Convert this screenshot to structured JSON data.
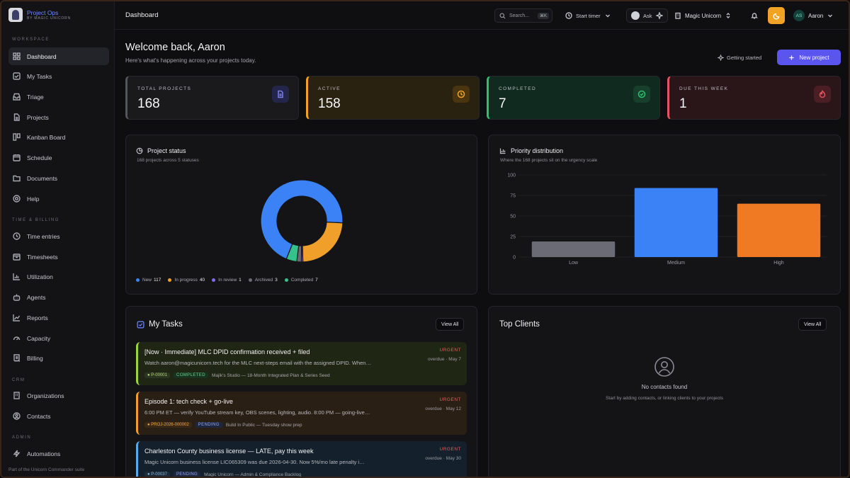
{
  "brand": {
    "title": "Project Ops",
    "subtitle": "BY MAGIC UNICORN"
  },
  "sidebar": {
    "sections": [
      {
        "label": "WORKSPACE"
      },
      {
        "label": "TIME & BILLING"
      },
      {
        "label": "CRM"
      },
      {
        "label": "ADMIN"
      }
    ],
    "items": [
      {
        "label": "Dashboard",
        "icon": "grid-icon",
        "active": true
      },
      {
        "label": "My Tasks",
        "icon": "checkbox-icon"
      },
      {
        "label": "Triage",
        "icon": "inbox-icon"
      },
      {
        "label": "Projects",
        "icon": "file-icon"
      },
      {
        "label": "Kanban Board",
        "icon": "kanban-icon"
      },
      {
        "label": "Schedule",
        "icon": "calendar-icon"
      },
      {
        "label": "Documents",
        "icon": "folder-icon"
      },
      {
        "label": "Help",
        "icon": "help-icon"
      },
      {
        "label": "Time entries",
        "icon": "clock-icon"
      },
      {
        "label": "Timesheets",
        "icon": "timesheet-icon"
      },
      {
        "label": "Utilization",
        "icon": "bar-chart-icon"
      },
      {
        "label": "Agents",
        "icon": "bot-icon"
      },
      {
        "label": "Reports",
        "icon": "line-chart-icon"
      },
      {
        "label": "Capacity",
        "icon": "gauge-icon"
      },
      {
        "label": "Billing",
        "icon": "receipt-icon"
      },
      {
        "label": "Organizations",
        "icon": "building-icon"
      },
      {
        "label": "Contacts",
        "icon": "contact-icon"
      },
      {
        "label": "Automations",
        "icon": "bolt-icon"
      }
    ],
    "footer": "Part of the Unicorn Commander suite"
  },
  "topbar": {
    "breadcrumb": "Dashboard",
    "search_label": "Search...",
    "search_shortcut": "⌘K",
    "timer_label": "Start timer",
    "ask_label": "Ask",
    "workspace_label": "Magic Unicorn",
    "user_initials": "AS",
    "user_name": "Aaron"
  },
  "header": {
    "title": "Welcome back, Aaron",
    "subtitle": "Here's what's happening across your projects today.",
    "getting_started": "Getting started",
    "new_project": "New project"
  },
  "stats": [
    {
      "label": "TOTAL PROJECTS",
      "value": "168",
      "color": "#7b7fe6"
    },
    {
      "label": "ACTIVE",
      "value": "158",
      "color": "#f1a326"
    },
    {
      "label": "COMPLETED",
      "value": "7",
      "color": "#2fbf71"
    },
    {
      "label": "DUE THIS WEEK",
      "value": "1",
      "color": "#e2555f"
    }
  ],
  "project_status": {
    "title": "Project status",
    "subtitle": "168 projects across 5 statuses",
    "legend": [
      {
        "label": "New",
        "value": "117",
        "color": "#3b82f6"
      },
      {
        "label": "In progress",
        "value": "40",
        "color": "#f0a02a"
      },
      {
        "label": "In review",
        "value": "1",
        "color": "#7c6cf0"
      },
      {
        "label": "Archived",
        "value": "3",
        "color": "#6b6b74"
      },
      {
        "label": "Completed",
        "value": "7",
        "color": "#35c28a"
      }
    ]
  },
  "priority": {
    "title": "Priority distribution",
    "subtitle": "Where the 168 projects sit on the urgency scale"
  },
  "chart_data": [
    {
      "type": "pie",
      "categories": [
        "New",
        "In progress",
        "In review",
        "Archived",
        "Completed"
      ],
      "values": [
        117,
        40,
        1,
        3,
        7
      ],
      "colors": [
        "#3b82f6",
        "#f0a02a",
        "#7c6cf0",
        "#6b6b74",
        "#35c28a"
      ],
      "title": "Project status",
      "legend": "bottom"
    },
    {
      "type": "bar",
      "categories": [
        "Low",
        "Medium",
        "High"
      ],
      "values": [
        19,
        84,
        65
      ],
      "colors": [
        "#6b6b75",
        "#3b82f6",
        "#f07a24"
      ],
      "title": "Priority distribution",
      "ylim": [
        0,
        100
      ],
      "yticks": [
        0,
        25,
        50,
        75,
        100
      ],
      "grid": true
    }
  ],
  "my_tasks": {
    "title": "My Tasks",
    "view_all": "View All",
    "tasks": [
      {
        "title": "[Now · Immediate] MLC DPID confirmation received + filed",
        "desc": "Watch aaron@magicunicorn.tech for the MLC next-steps email with the assigned DPID. When…",
        "priority": "URGENT",
        "due": "overdue · May 7",
        "id": "● P-00001",
        "status": "COMPLETED",
        "project": "Majik's Studio — 18-Month Integrated Plan & Series Seed"
      },
      {
        "title": "Episode 1: tech check + go-live",
        "desc": "6:00 PM ET — verify YouTube stream key, OBS scenes, lighting, audio. 8:00 PM — going-live…",
        "priority": "URGENT",
        "due": "overdue · May 12",
        "id": "● PROJ-2026-000002",
        "status": "PENDING",
        "project": "Build In Public — Tuesday show prep"
      },
      {
        "title": "Charleston County business license — LATE, pay this week",
        "desc": "Magic Unicorn business license LIC065309 was due 2026-04-30. Now 5%/mo late penalty i…",
        "priority": "URGENT",
        "due": "overdue · May 30",
        "id": "● P-00037",
        "status": "PENDING",
        "project": "Magic Unicorn — Admin & Compliance Backlog"
      }
    ]
  },
  "top_clients": {
    "title": "Top Clients",
    "view_all": "View All",
    "empty_title": "No contacts found",
    "empty_sub": "Start by adding contacts, or linking clients to your projects"
  }
}
